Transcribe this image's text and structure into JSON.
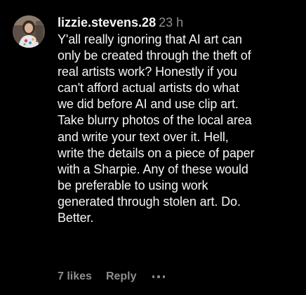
{
  "comment": {
    "username": "lizzie.stevens.28",
    "timestamp": "23 h",
    "text_lines": [
      "Y'all really ignoring that AI art can",
      "only be created through the theft of",
      "real artists work? Honestly if you",
      "can't afford actual artists do what",
      "we did before AI and use clip art.",
      "Take blurry photos of the local area",
      "and write your text over it. Hell,",
      "write the details on a piece of paper",
      "with a Sharpie. Any of these would",
      "be preferable to using work",
      "generated through stolen art. Do.",
      "Better."
    ],
    "likes_label": "7 likes",
    "reply_label": "Reply",
    "more_icon": "more-horizontal-icon"
  },
  "colors": {
    "background": "#000000",
    "primary_text": "#f5f5f5",
    "secondary_text": "#8e8e8e"
  }
}
